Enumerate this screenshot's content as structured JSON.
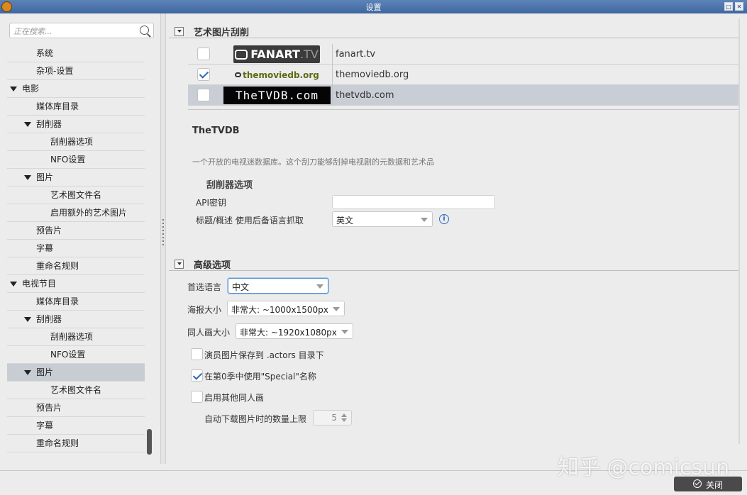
{
  "window": {
    "title": "设置"
  },
  "search": {
    "placeholder": "正在搜索..."
  },
  "tree": [
    {
      "label": "系统",
      "level": 2
    },
    {
      "label": "杂项-设置",
      "level": 2
    },
    {
      "label": "电影",
      "level": 0,
      "expanded": true
    },
    {
      "label": "媒体库目录",
      "level": 2
    },
    {
      "label": "刮削器",
      "level": 1,
      "expanded": true
    },
    {
      "label": "刮削器选项",
      "level": 3
    },
    {
      "label": "NFO设置",
      "level": 3
    },
    {
      "label": "图片",
      "level": 1,
      "expanded": true
    },
    {
      "label": "艺术图文件名",
      "level": 3
    },
    {
      "label": "启用额外的艺术图片",
      "level": 3
    },
    {
      "label": "预告片",
      "level": 2
    },
    {
      "label": "字幕",
      "level": 2
    },
    {
      "label": "重命名规则",
      "level": 2
    },
    {
      "label": "电视节目",
      "level": 0,
      "expanded": true
    },
    {
      "label": "媒体库目录",
      "level": 2
    },
    {
      "label": "刮削器",
      "level": 1,
      "expanded": true
    },
    {
      "label": "刮削器选项",
      "level": 3
    },
    {
      "label": "NFO设置",
      "level": 3
    },
    {
      "label": "图片",
      "level": 1,
      "expanded": true,
      "selected": true
    },
    {
      "label": "艺术图文件名",
      "level": 3
    },
    {
      "label": "预告片",
      "level": 2
    },
    {
      "label": "字幕",
      "level": 2
    },
    {
      "label": "重命名规则",
      "level": 2
    }
  ],
  "artwork": {
    "section_title": "艺术图片刮削",
    "scrapers": [
      {
        "name": "fanart.tv",
        "checked": false,
        "logo_text": "FANART",
        "logo_suffix": ".TV",
        "selected": false
      },
      {
        "name": "themoviedb.org",
        "checked": true,
        "logo_text": "themoviedb.org",
        "selected": false
      },
      {
        "name": "thetvdb.com",
        "checked": false,
        "logo_text": "TheTVDB.com",
        "selected": true
      }
    ],
    "detail": {
      "title": "TheTVDB",
      "description": "一个开放的电视迷数据库。这个刮刀能够刮掉电视剧的元数据和艺术品",
      "options_title": "刮削器选项",
      "api_key_label": "API密钥",
      "api_key_value": "",
      "fallback_label": "标题/概述 使用后备语言抓取",
      "fallback_value": "英文"
    }
  },
  "advanced": {
    "section_title": "高级选项",
    "preferred_language_label": "首选语言",
    "preferred_language_value": "中文",
    "poster_size_label": "海报大小",
    "poster_size_value": "非常大: ~1000x1500px",
    "fanart_size_label": "同人画大小",
    "fanart_size_value": "非常大: ~1920x1080px",
    "save_actor_images_label": "演员图片保存到 .actors 目录下",
    "save_actor_images_checked": false,
    "use_special_label": "在第0季中使用\"Special\"名称",
    "use_special_checked": true,
    "enable_extra_fanart_label": "启用其他同人画",
    "enable_extra_fanart_checked": false,
    "max_download_label": "自动下载图片时的数量上限",
    "max_download_value": "5"
  },
  "footer": {
    "close_label": "关闭"
  },
  "watermark": "知乎 @comicsun",
  "colors": {
    "titlebar": "#4a72aa",
    "selection": "#c9ced6",
    "check": "#2b6cb0"
  }
}
